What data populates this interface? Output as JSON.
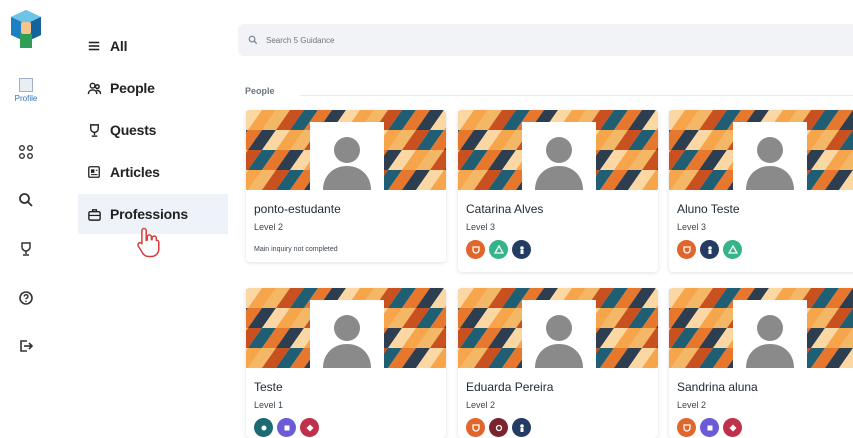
{
  "sidebar": {
    "profile_label": "Profile"
  },
  "nav": {
    "items": [
      {
        "label": "All",
        "icon": "list-icon"
      },
      {
        "label": "People",
        "icon": "people-icon"
      },
      {
        "label": "Quests",
        "icon": "trophy-icon"
      },
      {
        "label": "Articles",
        "icon": "article-icon"
      },
      {
        "label": "Professions",
        "icon": "briefcase-icon"
      }
    ],
    "active": "Professions"
  },
  "search": {
    "placeholder": "Search 5 Guidance"
  },
  "section": {
    "label": "People"
  },
  "people": [
    {
      "name": "ponto-estudante",
      "level": "Level 2",
      "note": "Main inquiry not completed",
      "badges": []
    },
    {
      "name": "Catarina Alves",
      "level": "Level 3",
      "badges": [
        "orange",
        "green",
        "navy"
      ]
    },
    {
      "name": "Aluno Teste",
      "level": "Level 3",
      "badges": [
        "orange",
        "navy",
        "green"
      ]
    },
    {
      "name": "Teste",
      "level": "Level 1",
      "badges": [
        "teal",
        "purple",
        "crimson"
      ]
    },
    {
      "name": "Eduarda Pereira",
      "level": "Level 2",
      "badges": [
        "orange",
        "maroon",
        "navy"
      ]
    },
    {
      "name": "Sandrina aluna",
      "level": "Level 2",
      "badges": [
        "orange",
        "purple",
        "crimson"
      ]
    }
  ],
  "colors": {
    "accent": "#2f6fb3",
    "badge_orange": "#e0662b",
    "badge_green": "#35b38a",
    "badge_navy": "#243b63",
    "badge_teal": "#1c6a73",
    "badge_purple": "#6b5bd6",
    "badge_crimson": "#c0304a",
    "badge_maroon": "#7a2430"
  }
}
